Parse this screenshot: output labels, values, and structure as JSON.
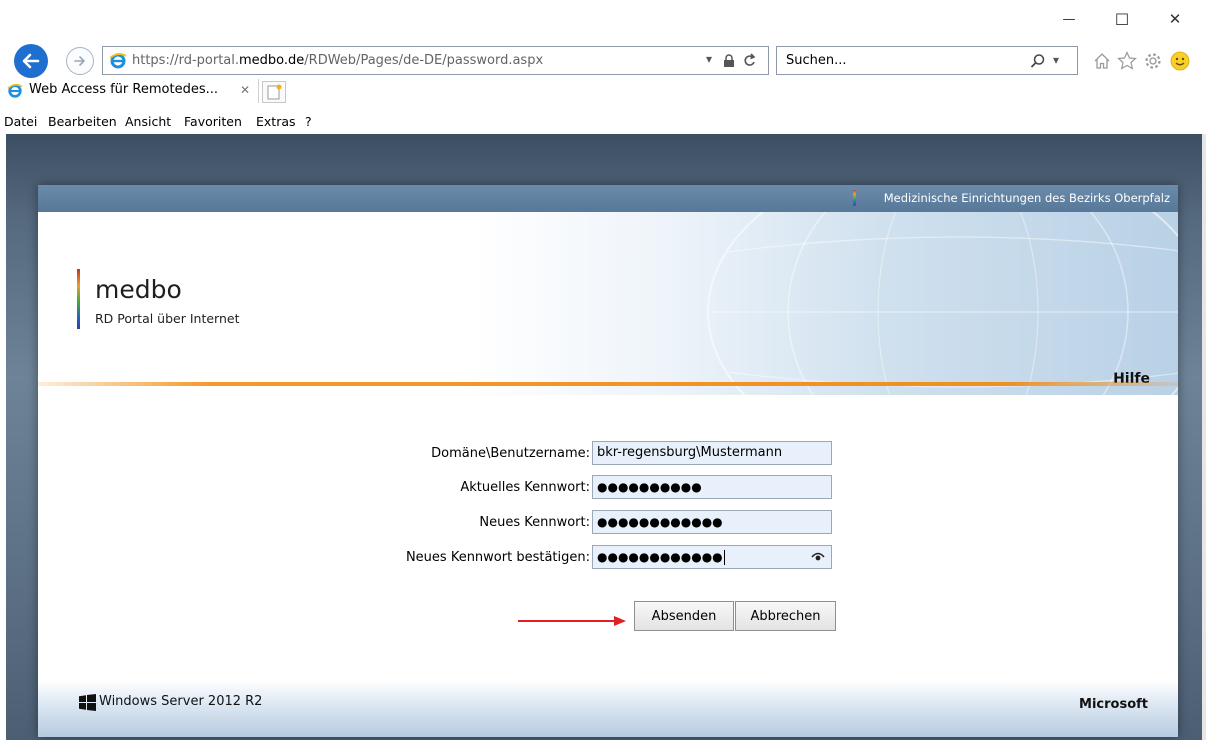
{
  "window": {
    "minimize_glyph": "—",
    "maximize_glyph": "☐",
    "close_glyph": "✕"
  },
  "address_bar": {
    "url_prefix": "https://rd-portal.",
    "url_domain": "medbo.de",
    "url_path": "/RDWeb/Pages/de-DE/password.aspx",
    "dropdown_glyph": "▾",
    "refresh_glyph": "C"
  },
  "search_bar": {
    "placeholder": "Suchen...",
    "dropdown_glyph": "▾"
  },
  "tab": {
    "title": "Web Access für Remotedes...",
    "close_glyph": "✕"
  },
  "menu": [
    "Datei",
    "Bearbeiten",
    "Ansicht",
    "Favoriten",
    "Extras",
    "?"
  ],
  "portal": {
    "org_name": "Medizinische Einrichtungen des Bezirks Oberpfalz",
    "brand": "medbo",
    "subtitle": "RD Portal über Internet",
    "help_link": "Hilfe"
  },
  "form": {
    "fields": [
      {
        "label": "Domäne\\Benutzername:",
        "value": "bkr-regensburg\\Mustermann"
      },
      {
        "label": "Aktuelles Kennwort:",
        "value": "●●●●●●●●●●"
      },
      {
        "label": "Neues Kennwort:",
        "value": "●●●●●●●●●●●●"
      },
      {
        "label": "Neues Kennwort bestätigen:",
        "value": "●●●●●●●●●●●●"
      }
    ],
    "submit_label": "Absenden",
    "cancel_label": "Abbrechen"
  },
  "footer": {
    "left_label": "Windows Server 2012 R2",
    "right_label": "Microsoft"
  },
  "colors": {
    "back_button": "#1e6fd0",
    "header_bar": "#6b8bab",
    "accent_line": "#f39a2a",
    "input_bg": "#e8f1fb",
    "arrow": "#e02020"
  }
}
